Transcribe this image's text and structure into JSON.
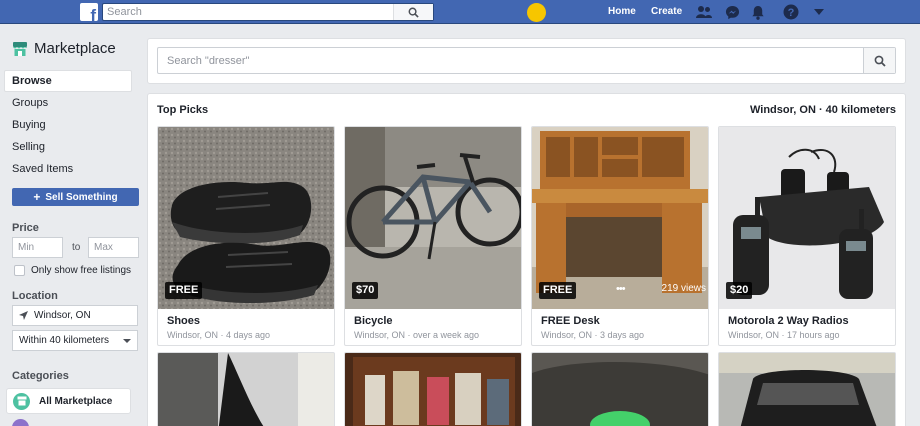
{
  "topbar": {
    "search_placeholder": "Search",
    "home": "Home",
    "create": "Create"
  },
  "sidebar": {
    "title": "Marketplace",
    "items": [
      {
        "label": "Browse"
      },
      {
        "label": "Groups"
      },
      {
        "label": "Buying"
      },
      {
        "label": "Selling"
      },
      {
        "label": "Saved Items"
      }
    ],
    "sell_button": "Sell Something",
    "price_label": "Price",
    "min_placeholder": "Min",
    "to_label": "to",
    "max_placeholder": "Max",
    "free_only_label": "Only show free listings",
    "location_label": "Location",
    "location_value": "Windsor, ON",
    "distance_value": "Within 40 kilometers",
    "categories_label": "Categories",
    "category_first": "All Marketplace"
  },
  "main": {
    "search_placeholder": "Search \"dresser\"",
    "section_title": "Top Picks",
    "location_radius": "Windsor, ON · 40 kilometers",
    "items": [
      {
        "title": "Shoes",
        "price": "FREE",
        "meta": "Windsor, ON · 4 days ago"
      },
      {
        "title": "Bicycle",
        "price": "$70",
        "meta": "Windsor, ON · over a week ago"
      },
      {
        "title": "FREE Desk",
        "price": "FREE",
        "meta": "Windsor, ON · 3 days ago",
        "views": "219 views",
        "more": "•••"
      },
      {
        "title": "Motorola 2 Way Radios",
        "price": "$20",
        "meta": "Windsor, ON · 17 hours ago"
      }
    ]
  },
  "colors": {
    "brand_blue": "#4267b2",
    "page_bg": "#e9ebee",
    "accent_green": "#4dc1a1"
  },
  "icons": [
    "facebook-logo",
    "search-icon",
    "friends-icon",
    "messenger-icon",
    "bell-icon",
    "help-icon",
    "caret-down-icon",
    "storefront-icon",
    "location-pin-icon",
    "plus-icon"
  ]
}
